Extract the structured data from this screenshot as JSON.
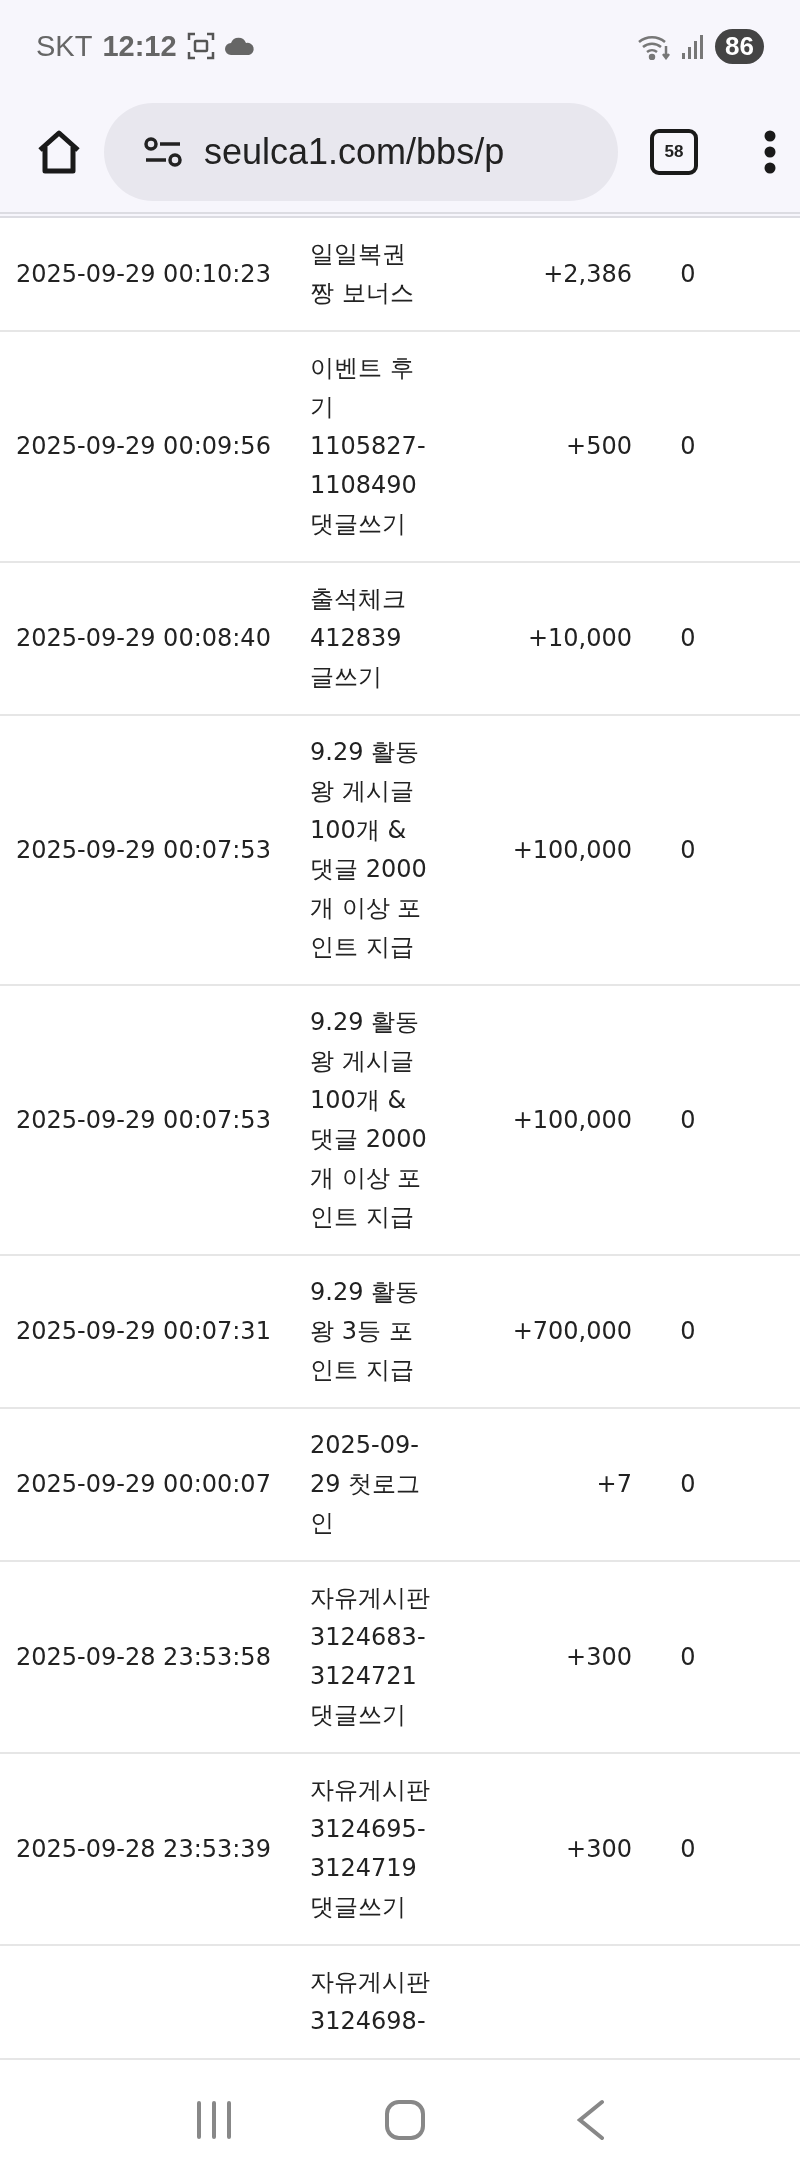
{
  "status_bar": {
    "carrier": "SKT",
    "time": "12:12",
    "battery": "86"
  },
  "toolbar": {
    "url": "seulca1.com/bbs/p",
    "tab_count": "58"
  },
  "table": {
    "rows": [
      {
        "datetime": "2025-09-29 00:10:23",
        "description": [
          "일일복권",
          "짱 보너스"
        ],
        "points": "+2,386",
        "column_4": "0"
      },
      {
        "datetime": "2025-09-29 00:09:56",
        "description": [
          "이벤트 후",
          "기",
          "1105827-",
          "1108490",
          "댓글쓰기"
        ],
        "points": "+500",
        "column_4": "0"
      },
      {
        "datetime": "2025-09-29 00:08:40",
        "description": [
          "출석체크",
          "412839",
          "글쓰기"
        ],
        "points": "+10,000",
        "column_4": "0"
      },
      {
        "datetime": "2025-09-29 00:07:53",
        "description": [
          "9.29 활동",
          "왕 게시글",
          "100개 &",
          "댓글 2000",
          "개 이상 포",
          "인트 지급"
        ],
        "points": "+100,000",
        "column_4": "0"
      },
      {
        "datetime": "2025-09-29 00:07:53",
        "description": [
          "9.29 활동",
          "왕 게시글",
          "100개 &",
          "댓글 2000",
          "개 이상 포",
          "인트 지급"
        ],
        "points": "+100,000",
        "column_4": "0"
      },
      {
        "datetime": "2025-09-29 00:07:31",
        "description": [
          "9.29 활동",
          "왕 3등 포",
          "인트 지급"
        ],
        "points": "+700,000",
        "column_4": "0"
      },
      {
        "datetime": "2025-09-29 00:00:07",
        "description": [
          "2025-09-",
          "29 첫로그",
          "인"
        ],
        "points": "+7",
        "column_4": "0"
      },
      {
        "datetime": "2025-09-28 23:53:58",
        "description": [
          "자유게시판",
          "3124683-",
          "3124721",
          "댓글쓰기"
        ],
        "points": "+300",
        "column_4": "0"
      },
      {
        "datetime": "2025-09-28 23:53:39",
        "description": [
          "자유게시판",
          "3124695-",
          "3124719",
          "댓글쓰기"
        ],
        "points": "+300",
        "column_4": "0"
      },
      {
        "description": [
          "자유게시판",
          "3124698-"
        ]
      }
    ]
  }
}
